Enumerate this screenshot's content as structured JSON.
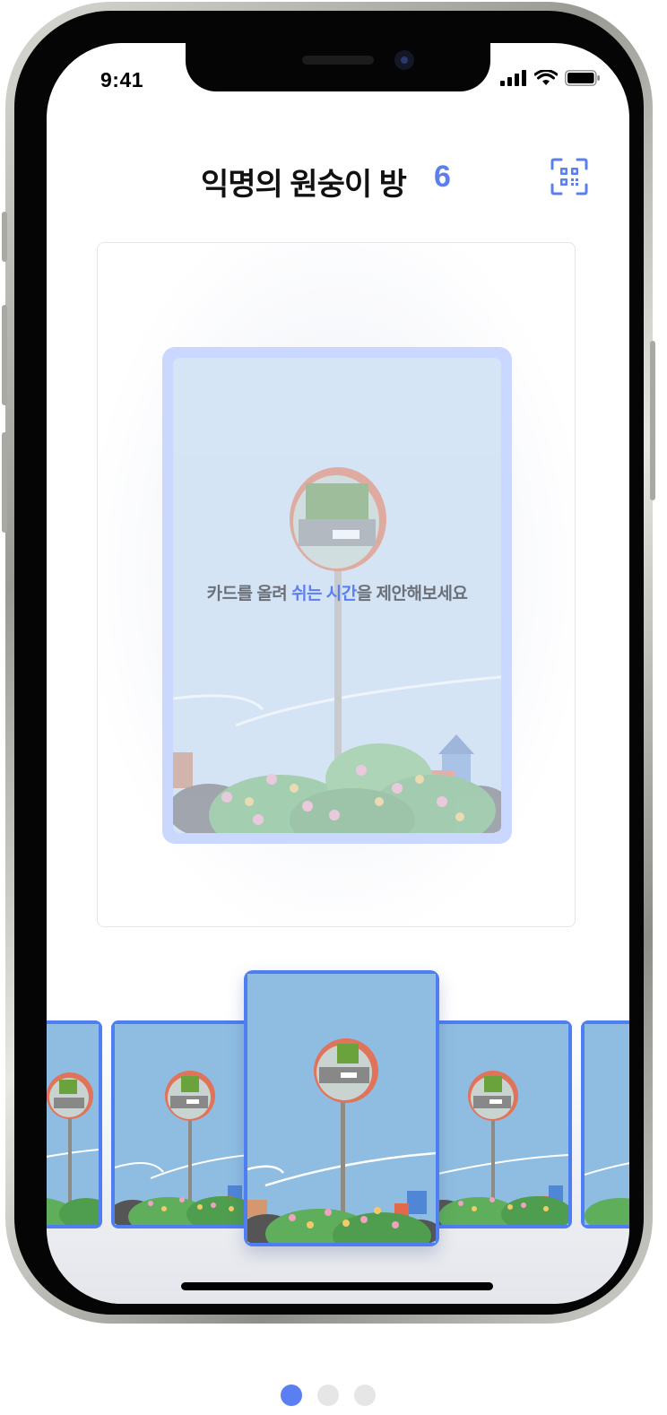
{
  "status_bar": {
    "time": "9:41"
  },
  "header": {
    "title": "익명의 원숭이 방",
    "count": "6",
    "qr_icon": "qr-scan-icon"
  },
  "drop_zone": {
    "prompt_before": "카드를 올려 ",
    "prompt_highlight": "쉬는 시간",
    "prompt_after": "을 제안해보세요"
  },
  "card_tray": {
    "card_count_visible": 5,
    "selected_index": 2
  },
  "pager": {
    "pages": 3,
    "active": 0
  },
  "colors": {
    "accent": "#5b7ef0",
    "card_bg": "#8fbde2",
    "drop_frame": "#cad8ff"
  }
}
